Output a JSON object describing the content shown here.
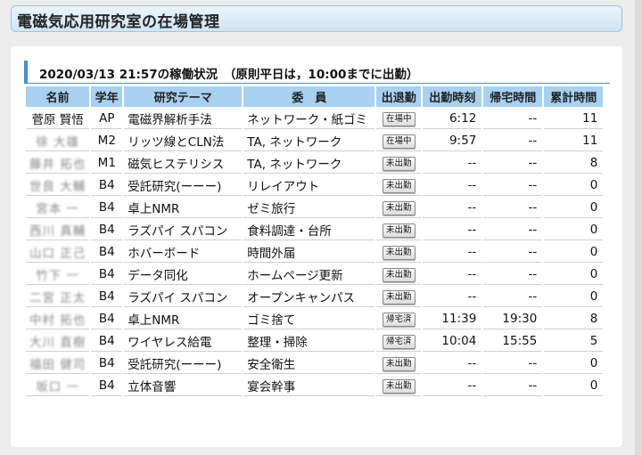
{
  "page_title": "電磁気応用研究室の在場管理",
  "section_title": "2020/03/13 21:57の稼働状況　（原則平日は，10:00までに出勤）",
  "headers": [
    "名前",
    "学年",
    "研究テーマ",
    "委　員",
    "出退勤",
    "出勤時刻",
    "帰宅時間",
    "累計時間"
  ],
  "rows": [
    {
      "name": "菅原 賢悟",
      "name_blurred": false,
      "grade": "AP",
      "theme": "電磁界解析手法",
      "committee": "ネットワーク・紙ゴミ",
      "status": "在場中",
      "in": "6:12",
      "out": "--",
      "total": "11"
    },
    {
      "name": "徐 大雄",
      "name_blurred": true,
      "grade": "M2",
      "theme": "リッツ線とCLN法",
      "committee": "TA, ネットワーク",
      "status": "在場中",
      "in": "9:57",
      "out": "--",
      "total": "11"
    },
    {
      "name": "藤井 拓也",
      "name_blurred": true,
      "grade": "M1",
      "theme": "磁気ヒステリシス",
      "committee": "TA, ネットワーク",
      "status": "未出勤",
      "in": "--",
      "out": "--",
      "total": "8"
    },
    {
      "name": "世良 大輔",
      "name_blurred": true,
      "grade": "B4",
      "theme": "受託研究(ーーー)",
      "committee": "リレイアウト",
      "status": "未出勤",
      "in": "--",
      "out": "--",
      "total": "0"
    },
    {
      "name": "宮本 一",
      "name_blurred": true,
      "grade": "B4",
      "theme": "卓上NMR",
      "committee": "ゼミ旅行",
      "status": "未出勤",
      "in": "--",
      "out": "--",
      "total": "0"
    },
    {
      "name": "西川 真輔",
      "name_blurred": true,
      "grade": "B4",
      "theme": "ラズパイ スパコン",
      "committee": "食料調達・台所",
      "status": "未出勤",
      "in": "--",
      "out": "--",
      "total": "0"
    },
    {
      "name": "山口 正己",
      "name_blurred": true,
      "grade": "B4",
      "theme": "ホバーボード",
      "committee": "時間外届",
      "status": "未出勤",
      "in": "--",
      "out": "--",
      "total": "0"
    },
    {
      "name": "竹下 一",
      "name_blurred": true,
      "grade": "B4",
      "theme": "データ同化",
      "committee": "ホームページ更新",
      "status": "未出勤",
      "in": "--",
      "out": "--",
      "total": "0"
    },
    {
      "name": "二宮 正太",
      "name_blurred": true,
      "grade": "B4",
      "theme": "ラズパイ スパコン",
      "committee": "オープンキャンパス",
      "status": "未出勤",
      "in": "--",
      "out": "--",
      "total": "0"
    },
    {
      "name": "中村 拓也",
      "name_blurred": true,
      "grade": "B4",
      "theme": "卓上NMR",
      "committee": "ゴミ捨て",
      "status": "帰宅済",
      "in": "11:39",
      "out": "19:30",
      "total": "8"
    },
    {
      "name": "大川 直樹",
      "name_blurred": true,
      "grade": "B4",
      "theme": "ワイヤレス給電",
      "committee": "整理・掃除",
      "status": "帰宅済",
      "in": "10:04",
      "out": "15:55",
      "total": "5"
    },
    {
      "name": "福田 健司",
      "name_blurred": true,
      "grade": "B4",
      "theme": "受託研究(ーーー)",
      "committee": "安全衛生",
      "status": "未出勤",
      "in": "--",
      "out": "--",
      "total": "0"
    },
    {
      "name": "坂口 一",
      "name_blurred": true,
      "grade": "B4",
      "theme": "立体音響",
      "committee": "宴会幹事",
      "status": "未出勤",
      "in": "--",
      "out": "--",
      "total": "0"
    }
  ],
  "colors": {
    "header_bg": "#a8d0f0",
    "accent": "#4a90c8",
    "title_bg": "#cfe4f5"
  }
}
